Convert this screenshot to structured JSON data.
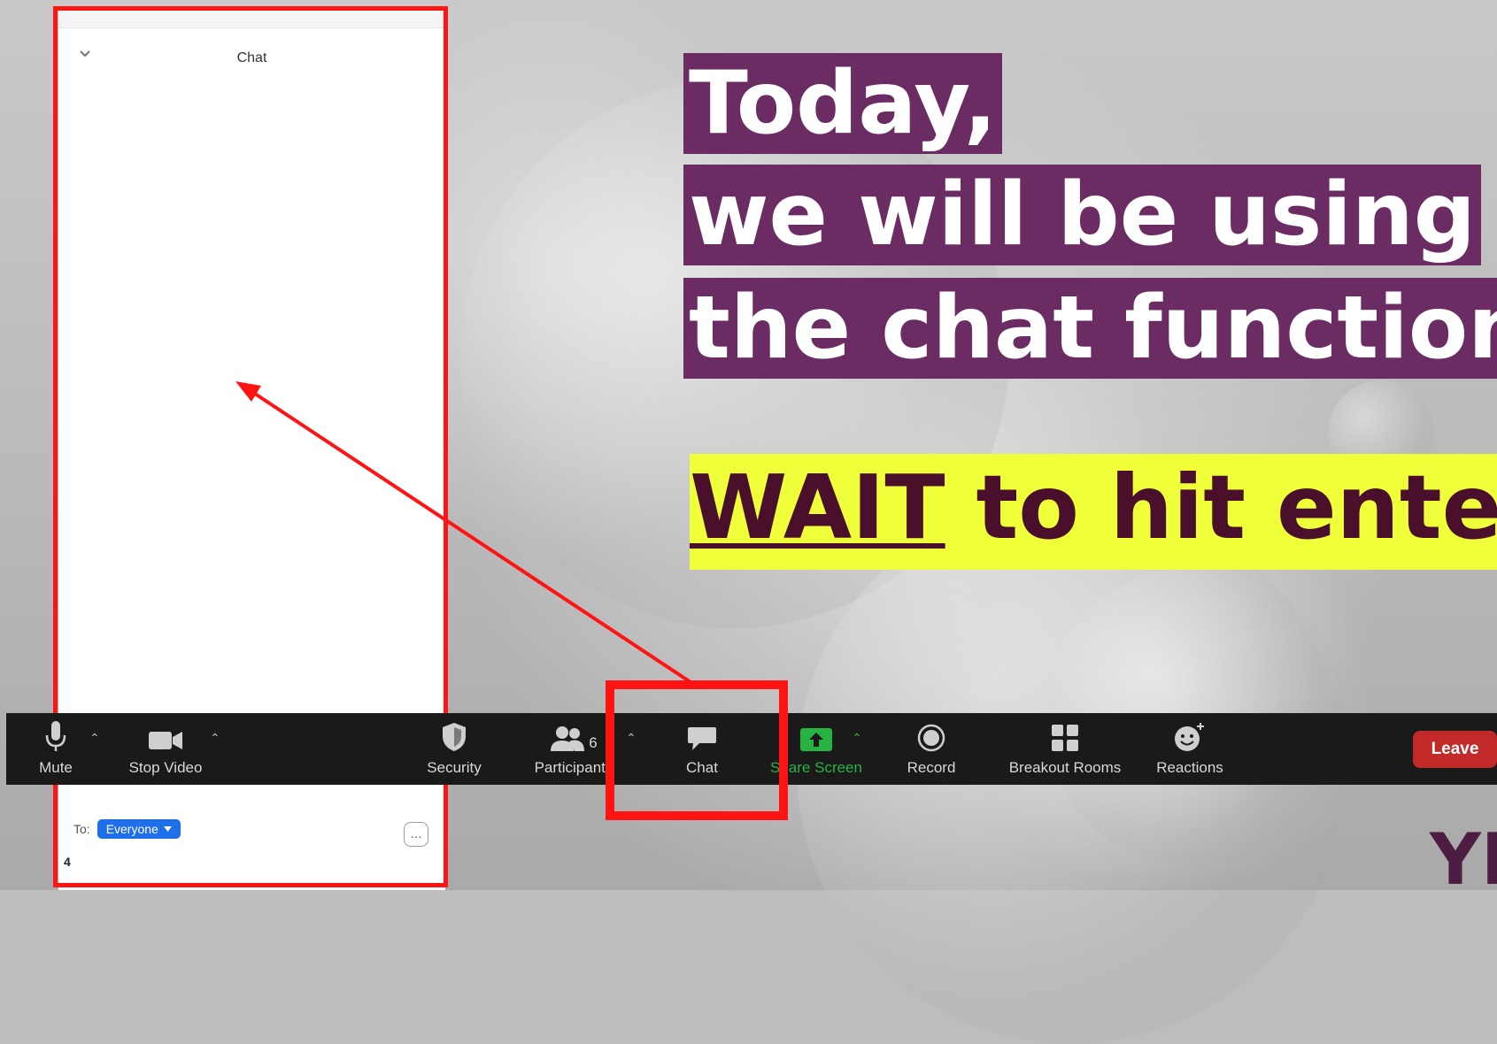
{
  "chat": {
    "title": "Chat",
    "to_label": "To:",
    "recipient": "Everyone",
    "more": "…",
    "input_value": "4"
  },
  "toolbar": {
    "mute": "Mute",
    "stop_video": "Stop Video",
    "security": "Security",
    "participants": "Participants",
    "participants_count": "6",
    "chat": "Chat",
    "share_screen": "Share Screen",
    "record": "Record",
    "breakout_rooms": "Breakout Rooms",
    "reactions": "Reactions",
    "leave": "Leave"
  },
  "slide": {
    "line1": "Today,",
    "line2": "we will be using",
    "line3": "the chat function",
    "wait_word": "WAIT",
    "wait_rest": " to hit enter",
    "logo_fragment": "YI"
  },
  "colors": {
    "headline_bg": "#6b2b63",
    "highlight_bg": "#efff3a",
    "annotation_red": "#ff1414",
    "leave_red": "#c22a2a",
    "share_green": "#26b341",
    "pill_blue": "#1f6fe8"
  }
}
